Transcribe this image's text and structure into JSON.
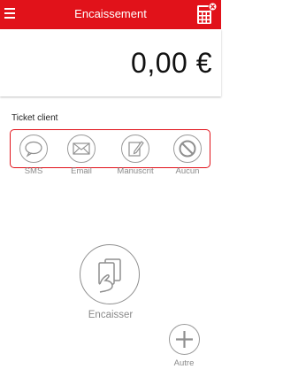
{
  "header": {
    "title": "Encaissement",
    "menu_icon": "hamburger-menu-icon",
    "calculator_icon": "calculator-icon",
    "close_badge_icon": "close-icon"
  },
  "amount": {
    "value": "0,00 €"
  },
  "ticket": {
    "label": "Ticket client",
    "options": [
      {
        "label": "SMS",
        "icon": "speech-bubble-icon"
      },
      {
        "label": "Email",
        "icon": "envelope-icon"
      },
      {
        "label": "Manuscrit",
        "icon": "pen-paper-icon"
      },
      {
        "label": "Aucun",
        "icon": "prohibited-icon"
      }
    ]
  },
  "actions": {
    "pay_label": "Encaisser",
    "pay_icon": "card-hand-icon",
    "other_label": "Autre",
    "other_icon": "plus-icon"
  },
  "colors": {
    "accent": "#e1121a",
    "muted": "#8a8a8a"
  }
}
